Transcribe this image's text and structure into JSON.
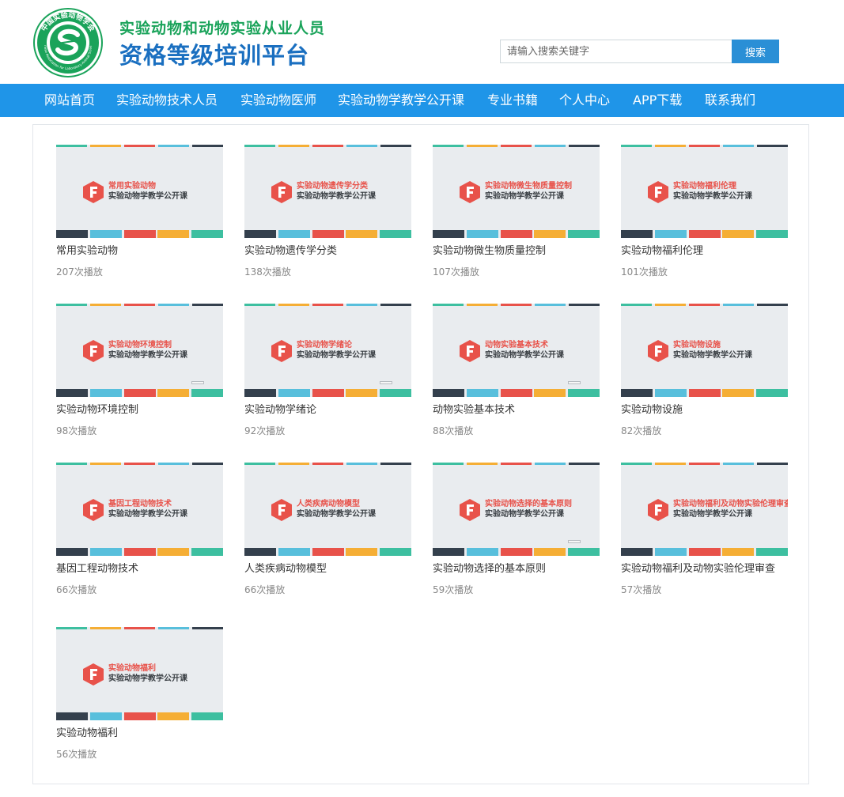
{
  "header": {
    "logo_ring_text": "中国实验动物学会",
    "logo_en_text": "Chinese Association for Laboratory Animal Sciences",
    "title_line1": "实验动物和动物实验从业人员",
    "title_line2": "资格等级培训平台",
    "search_placeholder": "请输入搜索关键字",
    "search_button": "搜索"
  },
  "nav": {
    "items": [
      {
        "label": "网站首页"
      },
      {
        "label": "实验动物技术人员"
      },
      {
        "label": "实验动物医师"
      },
      {
        "label": "实验动物学教学公开课"
      },
      {
        "label": "专业书籍"
      },
      {
        "label": "个人中心"
      },
      {
        "label": "APP下载"
      },
      {
        "label": "联系我们"
      }
    ]
  },
  "course_subtitle": "实验动物学教学公开课",
  "courses": [
    {
      "thumb_title": "常用实验动物",
      "title": "常用实验动物",
      "plays": "207次播放"
    },
    {
      "thumb_title": "实验动物遗传学分类",
      "title": "实验动物遗传学分类",
      "plays": "138次播放"
    },
    {
      "thumb_title": "实验动物微生物质量控制",
      "title": "实验动物微生物质量控制",
      "plays": "107次播放"
    },
    {
      "thumb_title": "实验动物福利伦理",
      "title": "实验动物福利伦理",
      "plays": "101次播放"
    },
    {
      "thumb_title": "实验动物环境控制",
      "title": "实验动物环境控制",
      "plays": "98次播放"
    },
    {
      "thumb_title": "实验动物学绪论",
      "title": "实验动物学绪论",
      "plays": "92次播放"
    },
    {
      "thumb_title": "动物实验基本技术",
      "title": "动物实验基本技术",
      "plays": "88次播放"
    },
    {
      "thumb_title": "实验动物设施",
      "title": "实验动物设施",
      "plays": "82次播放"
    },
    {
      "thumb_title": "基因工程动物技术",
      "title": "基因工程动物技术",
      "plays": "66次播放"
    },
    {
      "thumb_title": "人类疾病动物模型",
      "title": "人类疾病动物模型",
      "plays": "66次播放"
    },
    {
      "thumb_title": "实验动物选择的基本原则",
      "title": "实验动物选择的基本原则",
      "plays": "59次播放"
    },
    {
      "thumb_title": "实验动物福利及动物实验伦理审查",
      "title": "实验动物福利及动物实验伦理审查",
      "plays": "57次播放"
    },
    {
      "thumb_title": "实验动物福利",
      "title": "实验动物福利",
      "plays": "56次播放"
    }
  ],
  "colors": {
    "nav_bg": "#1f95e8",
    "search_btn": "#2a8fd6",
    "title_green": "#1aa35a",
    "title_blue": "#1a6fc0",
    "accent_red": "#e8524a",
    "stripe_top": [
      "#3dbfa0",
      "#f5ae35",
      "#e8524a",
      "#58bfdc",
      "#34404d"
    ],
    "stripe_bottom": [
      "#34404d",
      "#58bfdc",
      "#e8524a",
      "#f5ae35",
      "#3dbfa0"
    ]
  }
}
